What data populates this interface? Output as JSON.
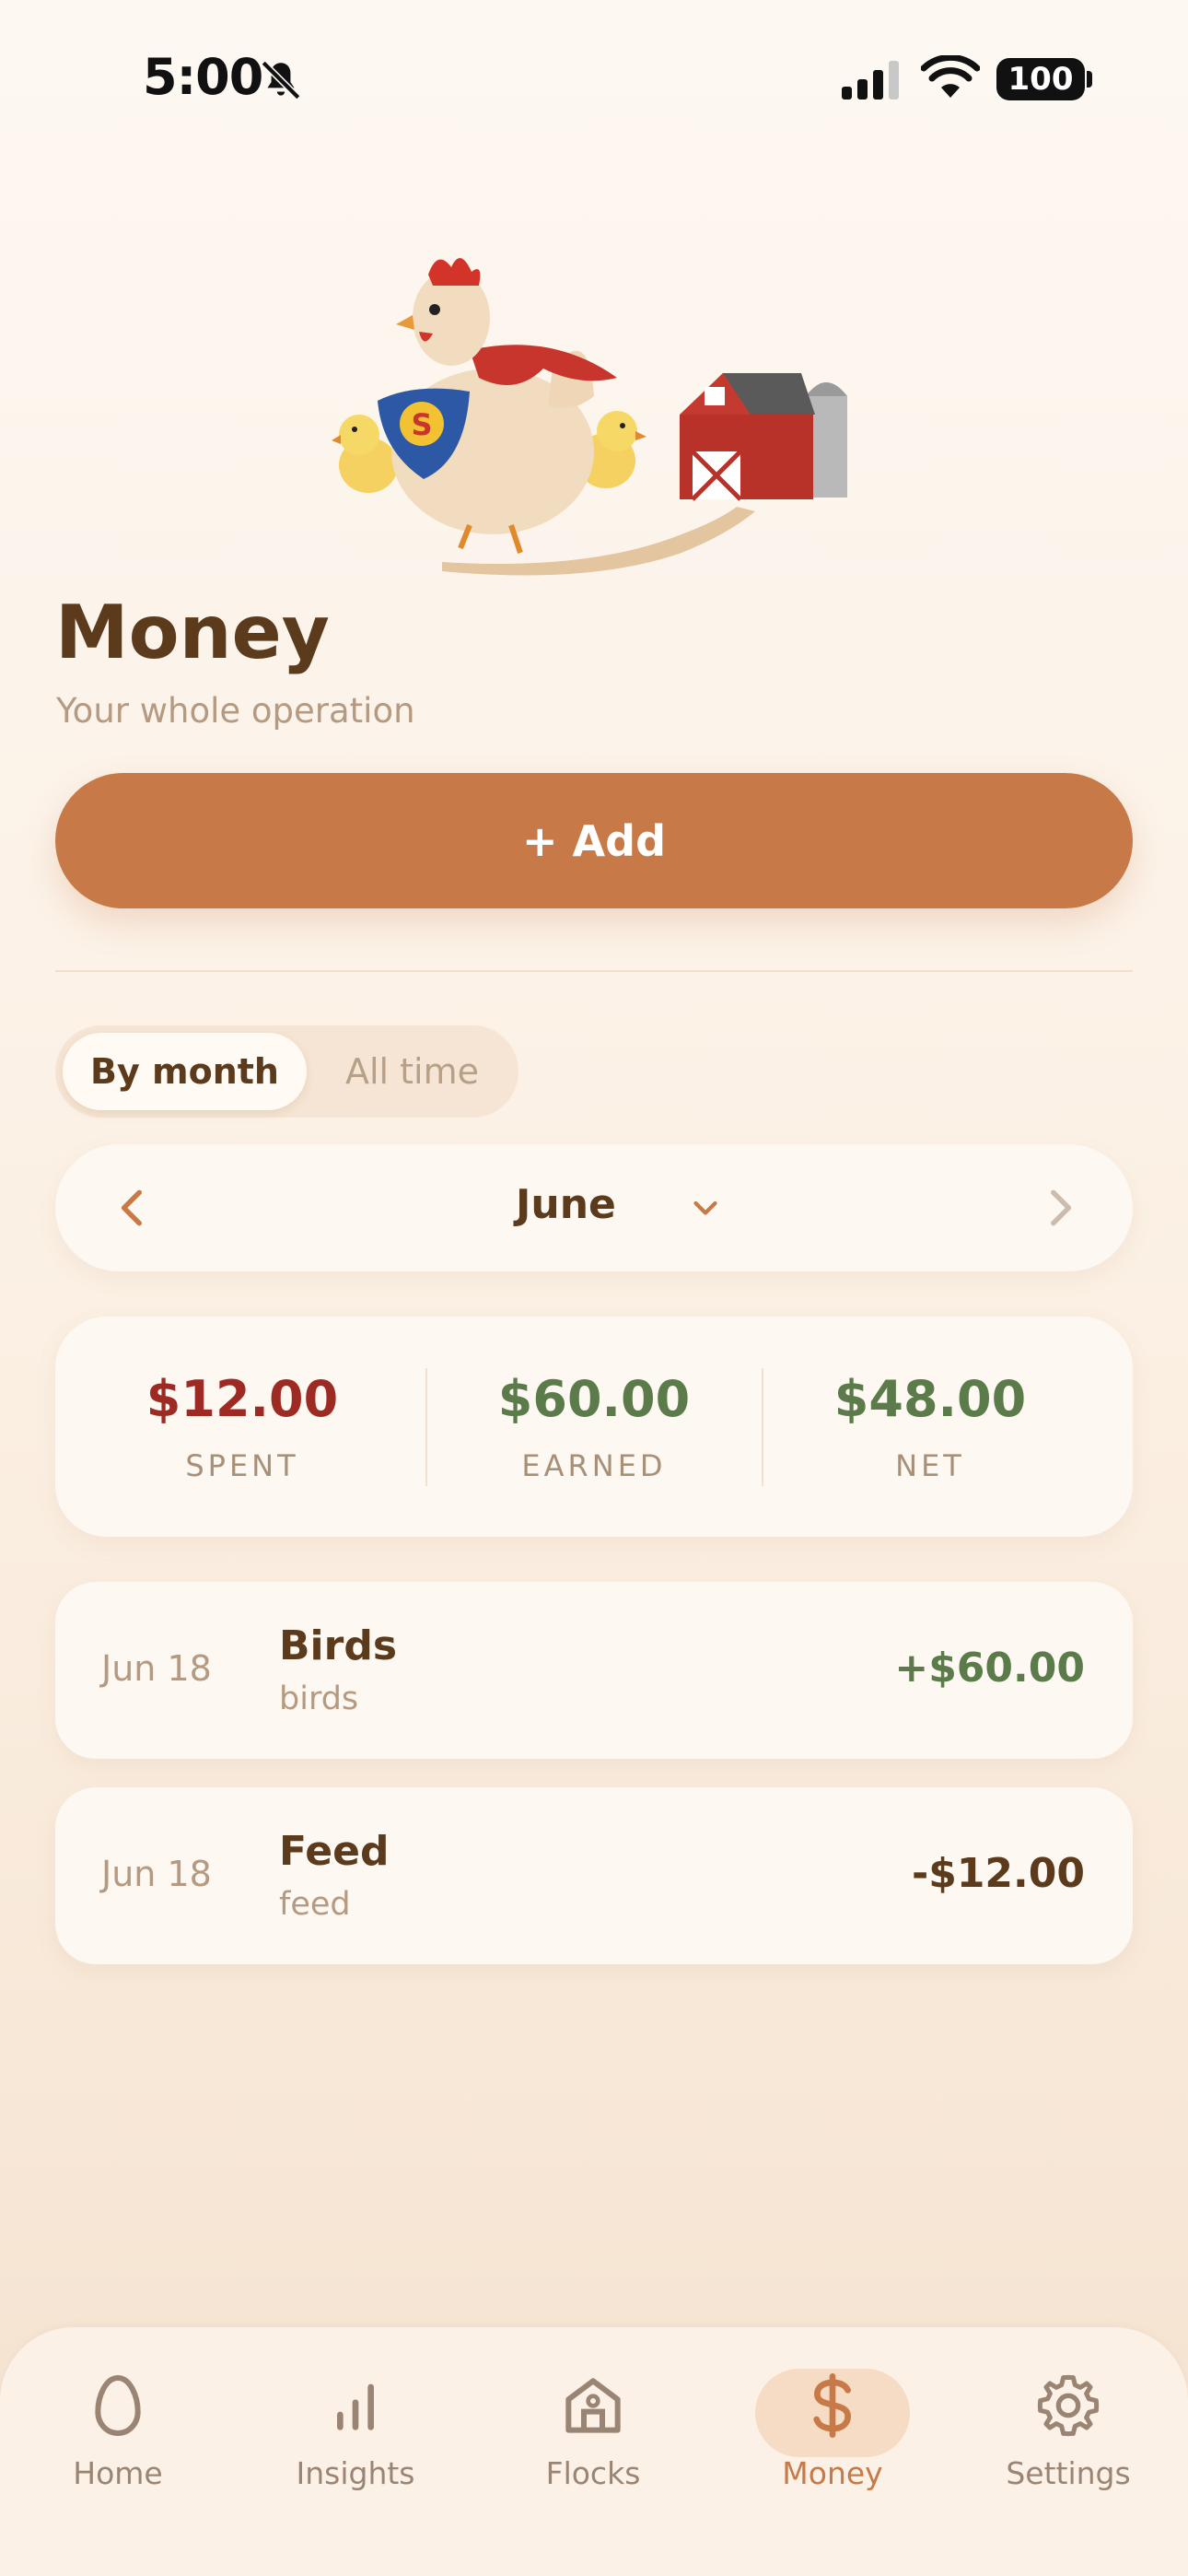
{
  "status_bar": {
    "time": "5:00",
    "battery": "100"
  },
  "header": {
    "title": "Money",
    "subtitle": "Your whole operation"
  },
  "actions": {
    "add_label": "+ Add"
  },
  "period_toggle": {
    "options": [
      "By month",
      "All time"
    ],
    "selected": "By month"
  },
  "month_nav": {
    "month": "June"
  },
  "summary": [
    {
      "value": "$12.00",
      "label": "SPENT",
      "color": "#9e2a24"
    },
    {
      "value": "$60.00",
      "label": "EARNED",
      "color": "#5b7b4a"
    },
    {
      "value": "$48.00",
      "label": "NET",
      "color": "#5b7b4a"
    }
  ],
  "transactions": [
    {
      "date": "Jun 18",
      "title": "Birds",
      "subtitle": "birds",
      "amount": "+$60.00",
      "color": "#5b7b4a"
    },
    {
      "date": "Jun 18",
      "title": "Feed",
      "subtitle": "feed",
      "amount": "-$12.00",
      "color": "#5c3a1c"
    }
  ],
  "tabs": [
    {
      "label": "Home",
      "icon": "egg-icon"
    },
    {
      "label": "Insights",
      "icon": "bar-chart-icon"
    },
    {
      "label": "Flocks",
      "icon": "barn-icon"
    },
    {
      "label": "Money",
      "icon": "dollar-icon",
      "active": true
    },
    {
      "label": "Settings",
      "icon": "gear-icon"
    }
  ],
  "colors": {
    "accent": "#c77a47",
    "spent": "#9e2a24",
    "earned": "#5b7b4a",
    "text": "#5c3a1c",
    "muted": "#b59a82"
  }
}
